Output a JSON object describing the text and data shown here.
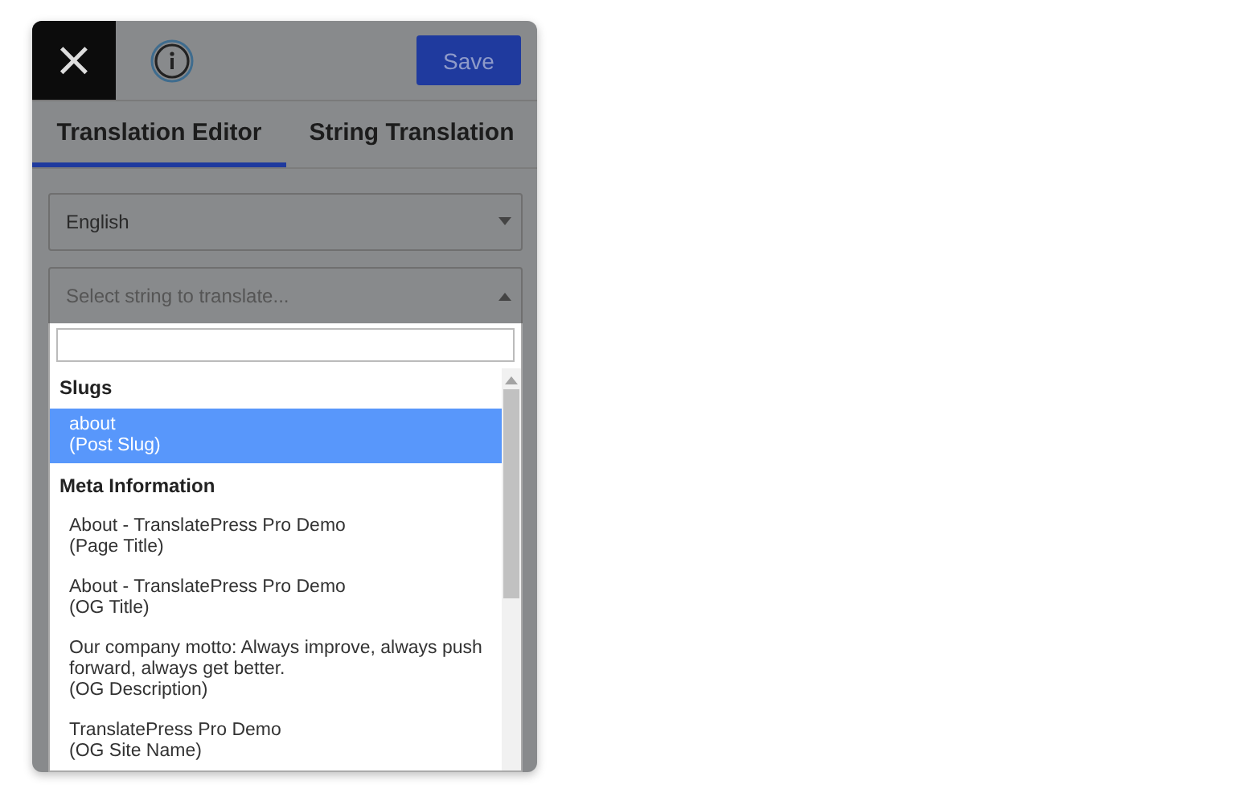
{
  "header": {
    "close_label": "×",
    "save_label": "Save"
  },
  "tabs": [
    {
      "label": "Translation Editor",
      "selected": true
    },
    {
      "label": "String Translation",
      "selected": false
    }
  ],
  "language_select": {
    "value": "English"
  },
  "string_select": {
    "placeholder": "Select string to translate...",
    "expanded": true
  },
  "dropdown": {
    "groups": [
      {
        "title": "Slugs",
        "options": [
          {
            "text": "about",
            "type": "(Post Slug)",
            "selected": true
          }
        ]
      },
      {
        "title": "Meta Information",
        "options": [
          {
            "text": "About - TranslatePress Pro Demo",
            "type": "(Page Title)",
            "selected": false
          },
          {
            "text": "About - TranslatePress Pro Demo",
            "type": "(OG Title)",
            "selected": false
          },
          {
            "text": "Our company motto: Always improve, always push forward, always get better.",
            "type": "(OG Description)",
            "selected": false
          },
          {
            "text": "TranslatePress Pro Demo",
            "type": "(OG Site Name)",
            "selected": false
          }
        ]
      }
    ]
  }
}
